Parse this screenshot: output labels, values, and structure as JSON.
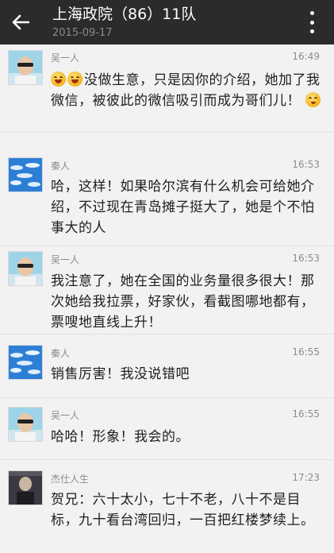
{
  "header": {
    "title": "上海政院（86）11队",
    "subtitle": "2015-09-17",
    "back_icon": "back-arrow-icon",
    "menu_icon": "more-vertical-icon"
  },
  "messages": [
    {
      "sender": "吴一人",
      "time": "16:49",
      "avatar": "avatar-sunglasses-man",
      "text": "没做生意，只是因你的介绍，她加了我微信，被彼此的微信吸引而成为哥们儿！",
      "emojis": [
        "grin-emoji",
        "grin-emoji",
        "thinking-emoji"
      ]
    },
    {
      "sender": "秦人",
      "time": "16:53",
      "avatar": "avatar-blue-sky-clouds",
      "text": "哈，这样！如果哈尔滨有什么机会可给她介绍，不过现在青岛摊子挺大了，她是个不怕事大的人"
    },
    {
      "sender": "吴一人",
      "time": "16:53",
      "avatar": "avatar-sunglasses-man",
      "text": "我注意了，她在全国的业务量很多很大！那次她给我拉票，好家伙，看截图哪地都有，票嗖地直线上升！"
    },
    {
      "sender": "秦人",
      "time": "16:55",
      "avatar": "avatar-blue-sky-clouds",
      "text": "销售厉害！我没说错吧"
    },
    {
      "sender": "吴一人",
      "time": "16:55",
      "avatar": "avatar-sunglasses-man",
      "text": "哈哈！形象！我会的。"
    },
    {
      "sender": "杰仕人生",
      "time": "17:23",
      "avatar": "avatar-dark-photo",
      "text": "贺兄：六十太小，七十不老，八十不是目标，九十看台湾回归，一百把红楼梦续上。"
    }
  ]
}
